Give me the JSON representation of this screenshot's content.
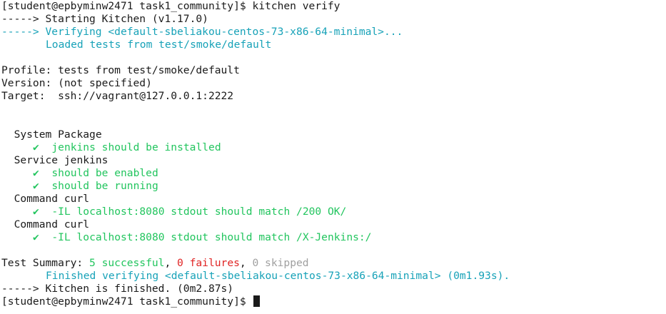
{
  "terminal": {
    "prompt": "[student@epbyminw2471 task1_community]$",
    "command": " kitchen verify",
    "arrow": "----->",
    "starting": " Starting Kitchen (v1.17.0)",
    "verifying": " Verifying <default-sbeliakou-centos-73-x86-64-minimal>...",
    "loaded": "Loaded tests from test/smoke/default",
    "profile": "Profile: tests from test/smoke/default",
    "version": "Version: (not specified)",
    "target": "Target:  ssh://vagrant@127.0.0.1:2222",
    "check": "✔",
    "groups": {
      "system_package": "System Package",
      "jenkins_installed": "jenkins should be installed",
      "service_jenkins": "Service jenkins",
      "enabled": "should be enabled",
      "running": "should be running",
      "command_curl_1": "Command curl",
      "curl_200": "-IL localhost:8080 stdout should match /200 OK/",
      "command_curl_2": "Command curl",
      "curl_jenkins": "-IL localhost:8080 stdout should match /X-Jenkins:/"
    },
    "summary": {
      "label": "Test Summary: ",
      "successful": "5 successful",
      "sep1": ", ",
      "failures": "0 failures",
      "sep2": ", ",
      "skipped": "0 skipped"
    },
    "finished": "Finished verifying <default-sbeliakou-centos-73-x86-64-minimal> (0m1.93s).",
    "kitchen_finished": " Kitchen is finished. (0m2.87s)",
    "final_prompt": "[student@epbyminw2471 task1_community]$ "
  },
  "colors": {
    "text": "#1a1a1a",
    "cyan": "#17a2b8",
    "green": "#22c55e",
    "red": "#e02424",
    "gray": "#a0a0a0",
    "background": "#ffffff"
  }
}
